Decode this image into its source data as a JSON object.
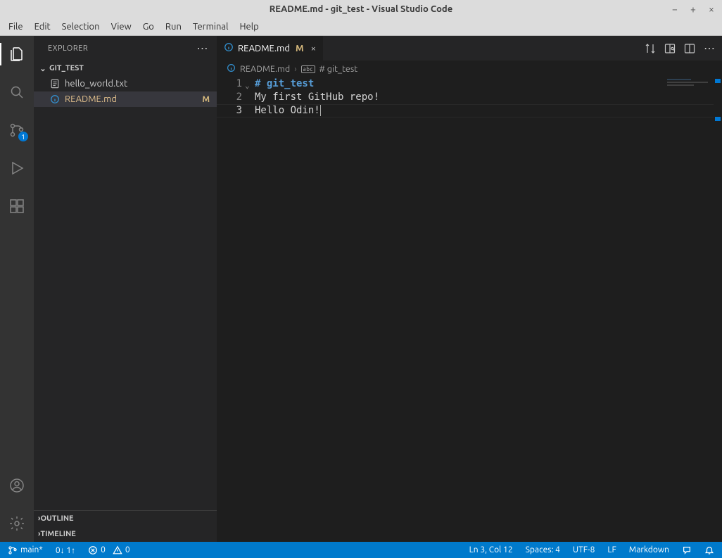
{
  "window": {
    "title": "README.md - git_test - Visual Studio Code"
  },
  "menubar": [
    "File",
    "Edit",
    "Selection",
    "View",
    "Go",
    "Run",
    "Terminal",
    "Help"
  ],
  "activitybar": {
    "scm_badge": "1"
  },
  "sidebar": {
    "title": "EXPLORER",
    "folder": "GIT_TEST",
    "files": [
      {
        "name": "hello_world.txt",
        "modified": false,
        "icon": "file"
      },
      {
        "name": "README.md",
        "modified": true,
        "icon": "info"
      }
    ],
    "modified_marker": "M",
    "outline": "OUTLINE",
    "timeline": "TIMELINE"
  },
  "tab": {
    "filename": "README.md",
    "modified_marker": "M"
  },
  "breadcrumbs": {
    "file": "README.md",
    "symbol": "# git_test"
  },
  "editor": {
    "lines": [
      {
        "n": "1",
        "text": "# git_test",
        "cls": "heading"
      },
      {
        "n": "2",
        "text": "My first GitHub repo!",
        "cls": ""
      },
      {
        "n": "3",
        "text": "Hello Odin!",
        "cls": ""
      }
    ],
    "active_line_index": 2
  },
  "statusbar": {
    "branch": "main*",
    "sync": "0↓ 1↑",
    "errors": "0",
    "warnings": "0",
    "cursor": "Ln 3, Col 12",
    "spaces": "Spaces: 4",
    "encoding": "UTF-8",
    "eol": "LF",
    "language": "Markdown"
  }
}
